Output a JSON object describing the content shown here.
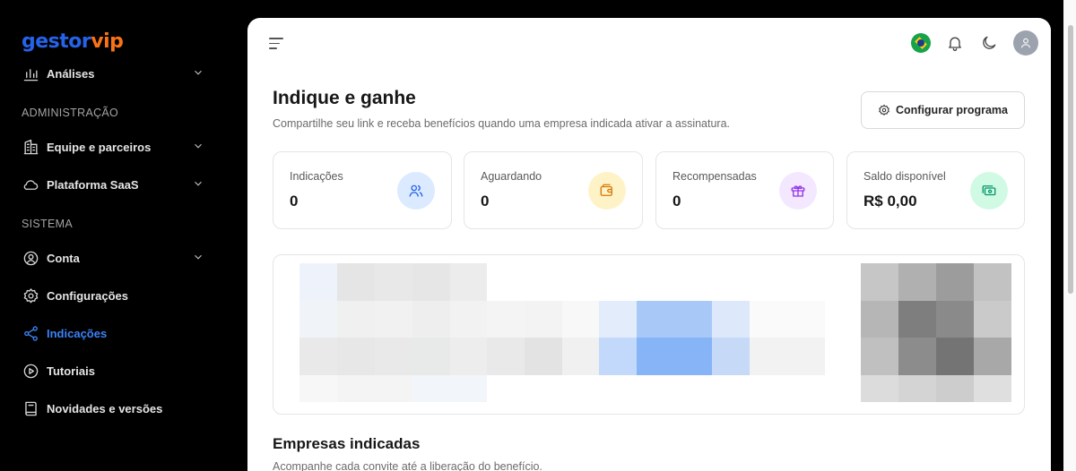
{
  "brand": {
    "part1": "gestor",
    "part2": "vip",
    "color1": "#2563eb",
    "color2": "#f97316"
  },
  "sidebar": {
    "items": [
      {
        "label": "Análises",
        "icon": "bar-chart-icon",
        "chevron": true
      },
      {
        "label": "Equipe e parceiros",
        "icon": "building-icon",
        "chevron": true
      },
      {
        "label": "Plataforma SaaS",
        "icon": "cloud-icon",
        "chevron": true
      },
      {
        "label": "Conta",
        "icon": "user-cog-icon",
        "chevron": true
      },
      {
        "label": "Configurações",
        "icon": "gear-icon",
        "chevron": false
      },
      {
        "label": "Indicações",
        "icon": "share-icon",
        "chevron": false,
        "active": true
      },
      {
        "label": "Tutoriais",
        "icon": "play-circle-icon",
        "chevron": false
      },
      {
        "label": "Novidades e versões",
        "icon": "book-icon",
        "chevron": false
      }
    ],
    "sections": {
      "admin": "ADMINISTRAÇÃO",
      "system": "SISTEMA"
    },
    "active_color": "#3b82f6"
  },
  "header": {
    "title": "Indique e ganhe",
    "subtitle": "Compartilhe seu link e receba benefícios quando uma empresa indicada ativar a assinatura.",
    "config_button": "Configurar programa"
  },
  "stats": [
    {
      "label": "Indicações",
      "value": "0",
      "icon": "users-icon",
      "bg": "#dbeafe",
      "fg": "#2563eb"
    },
    {
      "label": "Aguardando",
      "value": "0",
      "icon": "wallet-icon",
      "bg": "#fef3c7",
      "fg": "#d97706"
    },
    {
      "label": "Recompensadas",
      "value": "0",
      "icon": "gift-icon",
      "bg": "#f3e8ff",
      "fg": "#9333ea"
    },
    {
      "label": "Saldo disponível",
      "value": "R$ 0,00",
      "icon": "money-icon",
      "bg": "#d1fae5",
      "fg": "#059669"
    }
  ],
  "referred": {
    "title": "Empresas indicadas",
    "subtitle": "Acompanhe cada convite até a liberação do benefício."
  }
}
